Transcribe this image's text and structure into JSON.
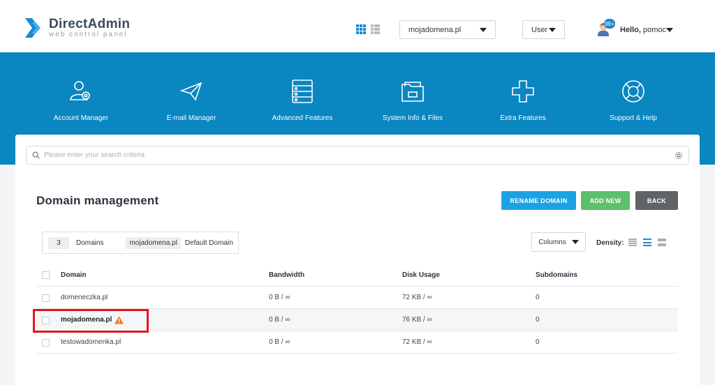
{
  "header": {
    "logo_title": "DirectAdmin",
    "logo_subtitle": "web control panel",
    "domain_select_value": "mojadomena.pl",
    "user_select_value": "User",
    "notification_count": "99+",
    "greeting": "Hello,",
    "username": "pomoc"
  },
  "nav": [
    {
      "label": "Account Manager",
      "icon": "account-manager-icon"
    },
    {
      "label": "E-mail Manager",
      "icon": "paper-plane-icon"
    },
    {
      "label": "Advanced Features",
      "icon": "server-icon"
    },
    {
      "label": "System Info & Files",
      "icon": "folder-icon"
    },
    {
      "label": "Extra Features",
      "icon": "plus-icon"
    },
    {
      "label": "Support & Help",
      "icon": "lifebuoy-icon"
    }
  ],
  "search": {
    "placeholder": "Please enter your search criteria"
  },
  "page": {
    "title": "Domain management",
    "rename_label": "RENAME DOMAIN",
    "add_label": "ADD NEW",
    "back_label": "BACK"
  },
  "summary": {
    "count": "3",
    "count_label": "Domains",
    "default_domain": "mojadomena.pl",
    "default_label": "Default Domain"
  },
  "toolbar": {
    "columns_label": "Columns",
    "density_label": "Density:"
  },
  "table": {
    "headers": {
      "domain": "Domain",
      "bandwidth": "Bandwidth",
      "disk": "Disk Usage",
      "subdomains": "Subdomains"
    },
    "rows": [
      {
        "domain": "domeneczka.pl",
        "bandwidth": "0 B / ∞",
        "disk": "72 KB / ∞",
        "subdomains": "0"
      },
      {
        "domain": "mojadomena.pl",
        "bandwidth": "0 B / ∞",
        "disk": "76 KB / ∞",
        "subdomains": "0",
        "warning": true
      },
      {
        "domain": "testowadomenka.pl",
        "bandwidth": "0 B / ∞",
        "disk": "72 KB / ∞",
        "subdomains": "0"
      }
    ]
  },
  "colors": {
    "nav_blue": "#0a86c1",
    "rename_button": "#1ba2e4",
    "add_button": "#5cbf6b",
    "back_button": "#5f6467",
    "highlight_box": "#e4141b",
    "warning": "#f07d1a"
  }
}
